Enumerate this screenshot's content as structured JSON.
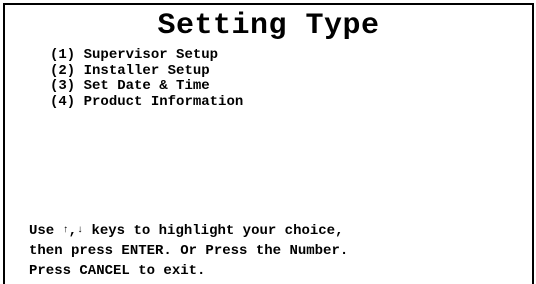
{
  "screen": {
    "title": "Setting Type"
  },
  "menu": {
    "items": [
      {
        "number": "(1)",
        "label": "Supervisor Setup"
      },
      {
        "number": "(2)",
        "label": "Installer Setup"
      },
      {
        "number": "(3)",
        "label": "Set Date & Time"
      },
      {
        "number": "(4)",
        "label": "Product Information"
      }
    ]
  },
  "help": {
    "line1_prefix": "Use ",
    "up_arrow": "↑",
    "separator": ",",
    "down_arrow": "↓",
    "line1_suffix": " keys to highlight your choice,",
    "line2": "then press ENTER. Or Press the Number.",
    "line3": "Press CANCEL to exit."
  }
}
